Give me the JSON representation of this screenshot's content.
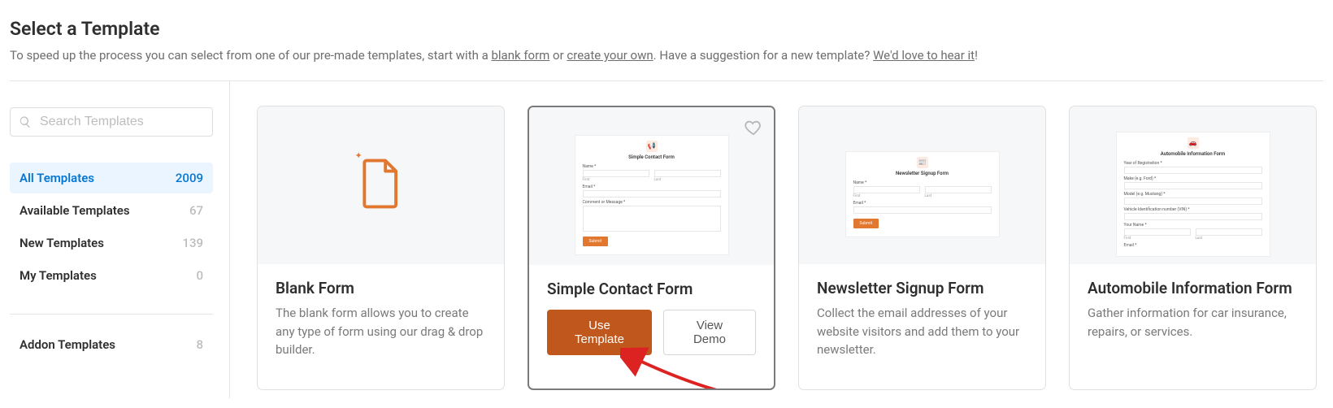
{
  "header": {
    "title": "Select a Template",
    "intro_pre": "To speed up the process you can select from one of our pre-made templates, start with a ",
    "link_blank": "blank form",
    "intro_or": " or ",
    "link_create": "create your own",
    "intro_suggest_pre": ". Have a suggestion for a new template? ",
    "link_feedback": "We'd love to hear it",
    "intro_end": "!"
  },
  "search": {
    "placeholder": "Search Templates"
  },
  "categories": [
    {
      "label": "All Templates",
      "count": "2009",
      "active": true
    },
    {
      "label": "Available Templates",
      "count": "67",
      "active": false
    },
    {
      "label": "New Templates",
      "count": "139",
      "active": false
    },
    {
      "label": "My Templates",
      "count": "0",
      "active": false
    }
  ],
  "addon": {
    "label": "Addon Templates",
    "count": "8"
  },
  "cards": [
    {
      "title": "Blank Form",
      "desc": "The blank form allows you to create any type of form using our drag & drop builder."
    },
    {
      "title": "Simple Contact Form",
      "desc": "",
      "use_label": "Use Template",
      "demo_label": "View Demo",
      "preview": {
        "title": "Simple Contact Form",
        "name": "Name *",
        "first": "First",
        "last": "Last",
        "email": "Email *",
        "comment": "Comment or Message *",
        "submit": "Submit"
      }
    },
    {
      "title": "Newsletter Signup Form",
      "desc": "Collect the email addresses of your website visitors and add them to your newsletter.",
      "preview": {
        "title": "Newsletter Signup Form",
        "name": "Name *",
        "first": "First",
        "last": "Last",
        "email": "Email *",
        "submit": "Submit"
      }
    },
    {
      "title": "Automobile Information Form",
      "desc": "Gather information for car insurance, repairs, or services.",
      "preview": {
        "title": "Automobile Information Form",
        "f1": "Year of Registration *",
        "f2": "Make (e.g. Ford) *",
        "f3": "Model (e.g. Mustang) *",
        "f4": "Vehicle Identification number (VIN) *",
        "f5": "Your Name *",
        "first": "First",
        "last": "Last",
        "f6": "Email *"
      }
    }
  ]
}
